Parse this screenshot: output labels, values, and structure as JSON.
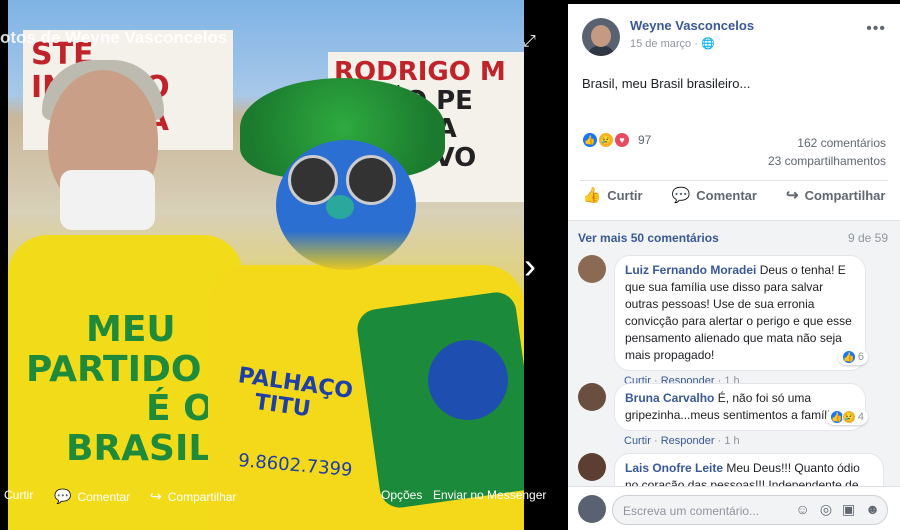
{
  "photo": {
    "album_title": "otos de Weyne Vasconcelos",
    "sign_left_line1": "STE INIMIGO",
    "sign_left_line2": "TRIA",
    "sign_right_line1": "RODRIGO M",
    "sign_right_line2": "R NÃO PE",
    "sign_right_line3": "É. MA",
    "sign_right_line4": "POVO",
    "shirt_left_line1": "MEU",
    "shirt_left_line2": "PARTIDO",
    "shirt_left_line3": "É O",
    "shirt_left_line4": "BRASIL",
    "shirt_right_line1": "PALHAÇO",
    "shirt_right_line2": "TITU",
    "shirt_right_phone": "9.8602.7399",
    "actions": {
      "curtir": "Curtir",
      "comentar": "Comentar",
      "compartilhar": "Compartilhar",
      "opcoes": "Opções",
      "enviar": "Enviar no Messenger"
    }
  },
  "post": {
    "author": "Weyne Vasconcelos",
    "date": "15 de março",
    "text": "Brasil, meu Brasil brasileiro...",
    "reaction_count": "97",
    "comments_count": "162 comentários",
    "shares_count": "23 compartilhamentos",
    "actions": {
      "like": "Curtir",
      "comment": "Comentar",
      "share": "Compartilhar"
    }
  },
  "comments": {
    "see_more": "Ver mais 50 comentários",
    "page": "9 de 59",
    "items": [
      {
        "name": "Luiz Fernando Moradei",
        "text": "Deus o tenha! E que sua família use disso para salvar outras pessoas! Use de sua erronia convicção para alertar o perigo e que esse pensamento alienado que mata não seja mais propagado!",
        "like": "Curtir",
        "reply": "Responder",
        "time": "1 h",
        "reactions": "6"
      },
      {
        "name": "Bruna Carvalho",
        "text": "É, não foi só uma gripezinha...meus sentimentos a família!",
        "like": "Curtir",
        "reply": "Responder",
        "time": "1 h",
        "reactions": "4"
      },
      {
        "name": "Lais Onofre Leite",
        "text": "Meu Deus!!! Quanto ódio no coração das pessoas!!! Independente de"
      }
    ]
  },
  "write_comment": {
    "placeholder": "Escreva um comentário..."
  },
  "colors": {
    "link_blue": "#385898",
    "like_blue": "#1877f2",
    "brazil_green": "#1f8a3a",
    "brazil_yellow": "#f2dc1a"
  }
}
